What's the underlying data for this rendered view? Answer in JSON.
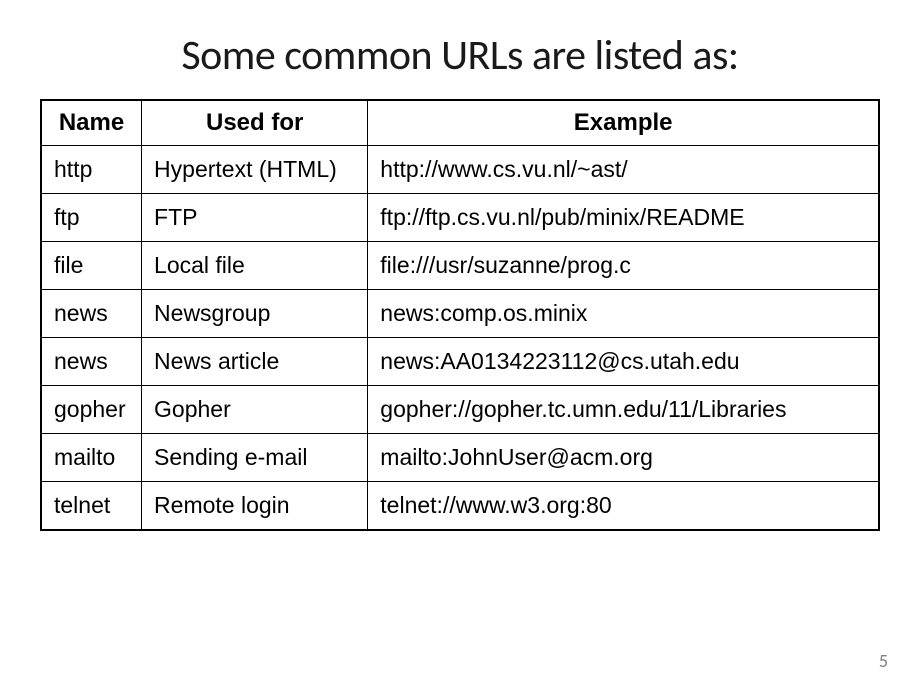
{
  "title": "Some common URLs are listed as:",
  "table": {
    "headers": [
      "Name",
      "Used for",
      "Example"
    ],
    "rows": [
      {
        "name": "http",
        "used_for": "Hypertext (HTML)",
        "example": "http://www.cs.vu.nl/~ast/"
      },
      {
        "name": "ftp",
        "used_for": "FTP",
        "example": "ftp://ftp.cs.vu.nl/pub/minix/README"
      },
      {
        "name": "file",
        "used_for": "Local file",
        "example": "file:///usr/suzanne/prog.c"
      },
      {
        "name": "news",
        "used_for": "Newsgroup",
        "example": "news:comp.os.minix"
      },
      {
        "name": "news",
        "used_for": "News article",
        "example": "news:AA0134223112@cs.utah.edu"
      },
      {
        "name": "gopher",
        "used_for": "Gopher",
        "example": "gopher://gopher.tc.umn.edu/11/Libraries"
      },
      {
        "name": "mailto",
        "used_for": "Sending e-mail",
        "example": "mailto:JohnUser@acm.org"
      },
      {
        "name": "telnet",
        "used_for": "Remote login",
        "example": "telnet://www.w3.org:80"
      }
    ]
  },
  "page_number": "5"
}
